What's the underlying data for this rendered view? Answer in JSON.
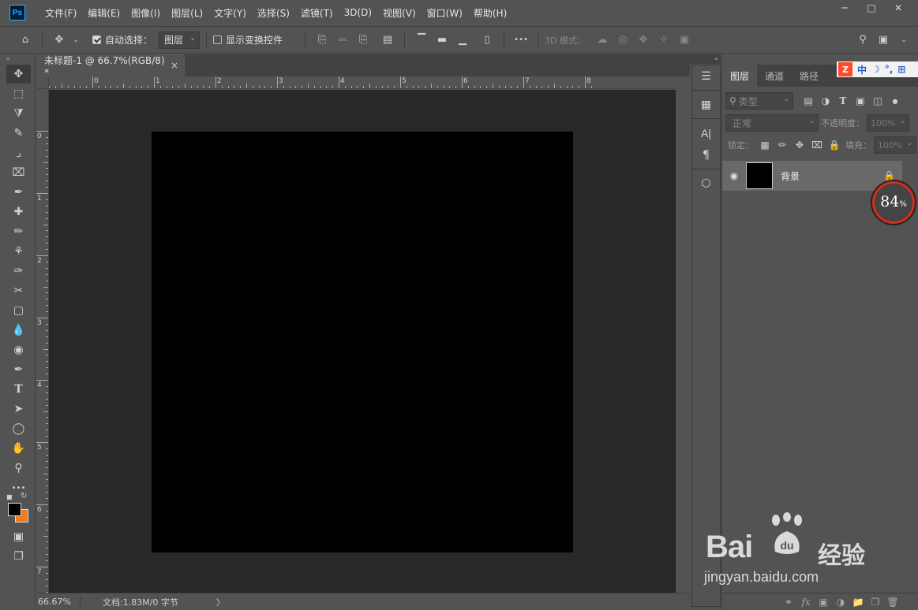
{
  "app": {
    "logo": "Ps"
  },
  "menu": [
    "文件(F)",
    "编辑(E)",
    "图像(I)",
    "图层(L)",
    "文字(Y)",
    "选择(S)",
    "滤镜(T)",
    "3D(D)",
    "视图(V)",
    "窗口(W)",
    "帮助(H)"
  ],
  "options": {
    "auto_select_label": "自动选择：",
    "auto_select_value": "图层",
    "show_transform_label": "显示变换控件",
    "more_label": "•••",
    "mode_3d_label": "3D 模式："
  },
  "document": {
    "tab_title": "未标题-1 @ 66.7%(RGB/8) *",
    "close_glyph": "×",
    "canvas_color": "#000000"
  },
  "ruler": {
    "top_labels": [
      "1",
      "0",
      "1",
      "2",
      "3",
      "4",
      "5",
      "6",
      "7",
      "8"
    ],
    "left_labels": [
      "0",
      "1",
      "2",
      "3",
      "4",
      "5",
      "6",
      "7"
    ]
  },
  "status": {
    "zoom": "66.67%",
    "doc_info": "文档:1.83M/0 字节",
    "arrow": "〉"
  },
  "colors": {
    "foreground": "#000000",
    "background": "#f27a1a"
  },
  "layers_panel": {
    "tabs": [
      "图层",
      "通道",
      "路径"
    ],
    "filter_placeholder": "类型",
    "blend_mode": "正常",
    "opacity_label": "不透明度：",
    "opacity_value": "100%",
    "lock_label": "锁定：",
    "fill_label": "填充：",
    "fill_value": "100%",
    "layer_name": "背景"
  },
  "ime": {
    "logo": "Z",
    "items": [
      "中",
      "☽",
      "°,",
      "⊞"
    ]
  },
  "perf_badge": {
    "value": "84",
    "unit": "%"
  },
  "watermark": {
    "main": "Bai",
    "paw": "du",
    "sub": "经验",
    "url": "jingyan.baidu.com"
  }
}
